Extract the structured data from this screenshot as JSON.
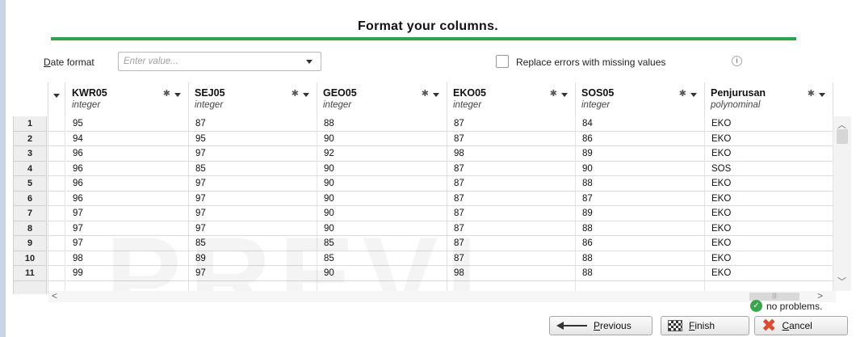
{
  "title": "Format your columns.",
  "date_format": {
    "label": "Date format",
    "placeholder": "Enter value..."
  },
  "replace_errors": {
    "label": "Replace errors with missing values",
    "checked": false
  },
  "columns": [
    {
      "name": "KWR05",
      "type": "integer"
    },
    {
      "name": "SEJ05",
      "type": "integer"
    },
    {
      "name": "GEO05",
      "type": "integer"
    },
    {
      "name": "EKO05",
      "type": "integer"
    },
    {
      "name": "SOS05",
      "type": "integer"
    },
    {
      "name": "Penjurusan",
      "type": "polynominal"
    }
  ],
  "rows": [
    {
      "num": "1",
      "values": [
        "95",
        "87",
        "88",
        "87",
        "84",
        "EKO"
      ]
    },
    {
      "num": "2",
      "values": [
        "94",
        "95",
        "90",
        "87",
        "86",
        "EKO"
      ]
    },
    {
      "num": "3",
      "values": [
        "96",
        "97",
        "92",
        "98",
        "89",
        "EKO"
      ]
    },
    {
      "num": "4",
      "values": [
        "96",
        "85",
        "90",
        "87",
        "90",
        "SOS"
      ]
    },
    {
      "num": "5",
      "values": [
        "96",
        "97",
        "90",
        "87",
        "88",
        "EKO"
      ]
    },
    {
      "num": "6",
      "values": [
        "96",
        "97",
        "90",
        "87",
        "87",
        "EKO"
      ]
    },
    {
      "num": "7",
      "values": [
        "97",
        "97",
        "90",
        "87",
        "89",
        "EKO"
      ]
    },
    {
      "num": "8",
      "values": [
        "97",
        "97",
        "90",
        "87",
        "88",
        "EKO"
      ]
    },
    {
      "num": "9",
      "values": [
        "97",
        "85",
        "85",
        "87",
        "86",
        "EKO"
      ]
    },
    {
      "num": "10",
      "values": [
        "98",
        "89",
        "85",
        "87",
        "88",
        "EKO"
      ]
    },
    {
      "num": "11",
      "values": [
        "99",
        "97",
        "90",
        "98",
        "88",
        "EKO"
      ]
    }
  ],
  "watermark": "PREVI...",
  "status": {
    "text": "no problems.",
    "icon": "check-circle-icon",
    "color": "#3aa64a"
  },
  "buttons": {
    "previous": "Previous",
    "finish": "Finish",
    "cancel": "Cancel"
  },
  "accent_color": "#2ea34b"
}
